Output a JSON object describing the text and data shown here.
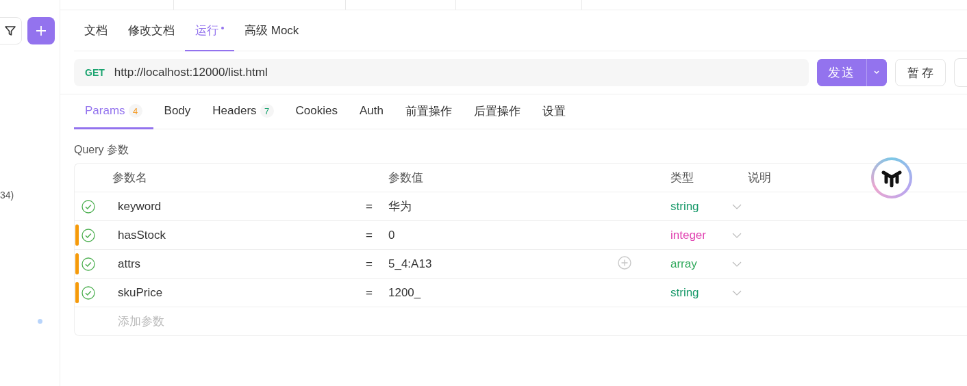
{
  "sidebar": {
    "snippet": "34)"
  },
  "doc_tabs": [
    {
      "label": "文档",
      "selected": false,
      "dirty": false
    },
    {
      "label": "修改文档",
      "selected": false,
      "dirty": false
    },
    {
      "label": "运行",
      "selected": true,
      "dirty": true
    },
    {
      "label": "高级 Mock",
      "selected": false,
      "dirty": false
    }
  ],
  "request": {
    "method": "GET",
    "url": "http://localhost:12000/list.html",
    "send_label": "发送",
    "save_label": "暂 存"
  },
  "request_tabs": [
    {
      "label": "Params",
      "count": "4",
      "color": "#f59a23",
      "selected": true
    },
    {
      "label": "Body",
      "selected": false
    },
    {
      "label": "Headers",
      "count": "7",
      "color": "#1aa36f",
      "selected": false
    },
    {
      "label": "Cookies",
      "selected": false
    },
    {
      "label": "Auth",
      "selected": false
    },
    {
      "label": "前置操作",
      "selected": false
    },
    {
      "label": "后置操作",
      "selected": false
    },
    {
      "label": "设置",
      "selected": false
    }
  ],
  "section_title": "Query 参数",
  "table": {
    "columns": [
      "参数名",
      "参数值",
      "类型",
      "说明"
    ],
    "rows": [
      {
        "enabled": true,
        "modified": false,
        "name": "keyword",
        "eq": "=",
        "value": "华为",
        "show_add_icon": false,
        "type": "string",
        "color": "#1a9a6b"
      },
      {
        "enabled": true,
        "modified": true,
        "name": "hasStock",
        "eq": "=",
        "value": "0",
        "show_add_icon": false,
        "type": "integer",
        "color": "#e040b0"
      },
      {
        "enabled": true,
        "modified": true,
        "name": "attrs",
        "eq": "=",
        "value": "5_4:A13",
        "show_add_icon": true,
        "type": "array",
        "color": "#2ea85a"
      },
      {
        "enabled": true,
        "modified": true,
        "name": "skuPrice",
        "eq": "=",
        "value": "1200_",
        "show_add_icon": false,
        "type": "string",
        "color": "#1a9a6b"
      }
    ],
    "add_placeholder": "添加参数"
  }
}
